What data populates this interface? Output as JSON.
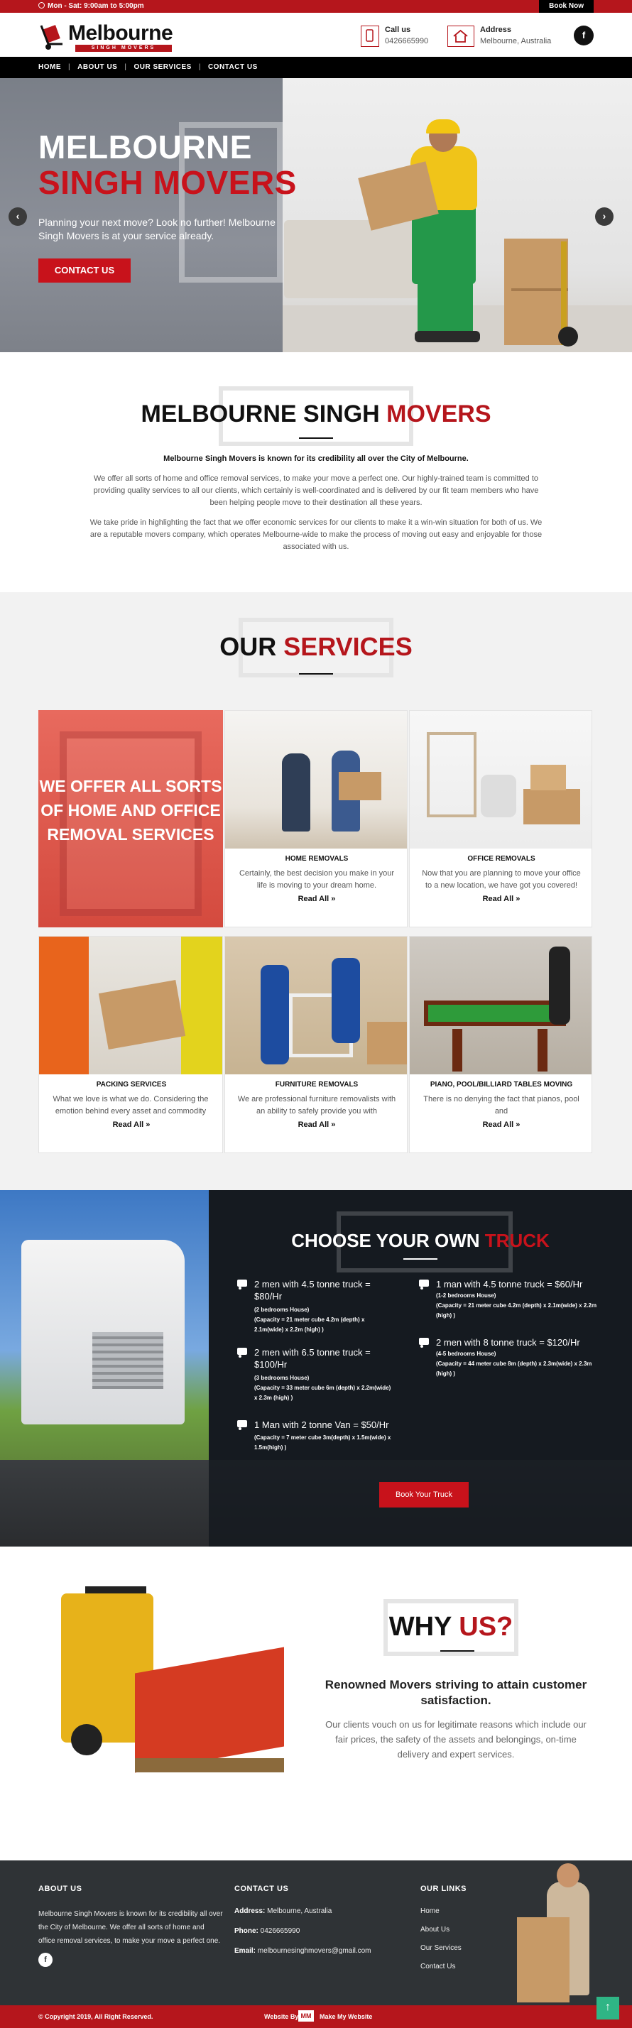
{
  "topbar": {
    "hours": "Mon - Sat: 9:00am to 5:00pm",
    "book_now": "Book Now"
  },
  "header": {
    "logo_name": "Melbourne",
    "logo_sub": "SINGH MOVERS",
    "call_title": "Call us",
    "call_value": "0426665990",
    "address_title": "Address",
    "address_value": "Melbourne, Australia",
    "fb": "f"
  },
  "nav": {
    "items": [
      "HOME",
      "ABOUT US",
      "OUR SERVICES",
      "CONTACT US"
    ],
    "sep": "|"
  },
  "hero": {
    "title_line1": "MELBOURNE",
    "title_line2": "SINGH MOVERS",
    "tagline": "Planning your next move? Look no further! Melbourne Singh Movers is at your service already.",
    "cta": "CONTACT US",
    "prev": "‹",
    "next": "›"
  },
  "about": {
    "title_black": "MELBOURNE SINGH",
    "title_red": "MOVERS",
    "lead": "Melbourne Singh Movers is known for its credibility all over the City of Melbourne.",
    "para1": "We offer all sorts of home and office removal services, to make your move a perfect one. Our highly-trained team is committed to providing quality services to all our clients, which certainly is well-coordinated and is delivered by our fit team members who have been helping people move to their destination all these years.",
    "para2": "We take pride in highlighting the fact that we offer economic services for our clients to make it a win-win situation for both of us. We are a reputable movers company, which operates Melbourne-wide to make the process of moving out easy and enjoyable for those associated with us."
  },
  "services": {
    "title_black": "OUR",
    "title_red": "SERVICES",
    "promo": "WE OFFER ALL SORTS OF HOME AND OFFICE REMOVAL SERVICES",
    "read_all": "Read All »",
    "cards": [
      {
        "title": "HOME REMOVALS",
        "desc": "Certainly, the best decision you make in your life is moving to your dream home."
      },
      {
        "title": "OFFICE REMOVALS",
        "desc": "Now that you are planning to move your office to a new location, we have got you covered!"
      },
      {
        "title": "PACKING SERVICES",
        "desc": "What we love is what we do. Considering the emotion behind every asset and commodity"
      },
      {
        "title": "FURNITURE REMOVALS",
        "desc": "We are professional furniture removalists with an ability to safely provide you with"
      },
      {
        "title": "PIANO, POOL/BILLIARD TABLES MOVING",
        "desc": "There is no denying the fact that pianos, pool and"
      }
    ]
  },
  "trucks": {
    "title_white": "CHOOSE YOUR OWN",
    "title_red": "TRUCK",
    "options": [
      {
        "title": "2 men with 4.5 tonne truck = $80/Hr",
        "house": "(2 bedrooms House)",
        "capacity": "(Capacity = 21 meter cube 4.2m (depth) x 2.1m(wide) x 2.2m (high) )"
      },
      {
        "title": "2 men with 6.5 tonne truck = $100/Hr",
        "house": "(3 bedrooms House)",
        "capacity": "(Capacity = 33 meter cube 6m (depth) x 2.2m(wide) x 2.3m (high) )"
      },
      {
        "title": "1 Man with 2 tonne Van = $50/Hr",
        "house": "",
        "capacity": "(Capacity = 7 meter cube 3m(depth) x 1.5m(wide) x 1.5m(high) )"
      },
      {
        "title": "1 man with 4.5 tonne truck = $60/Hr",
        "house": "(1-2 bedrooms House)",
        "capacity": "(Capacity = 21 meter cube 4.2m (depth) x 2.1m(wide) x 2.2m (high) )"
      },
      {
        "title": "2 men with 8 tonne truck = $120/Hr",
        "house": "(4-5 bedrooms House)",
        "capacity": "(Capacity = 44 meter cube 8m (depth) x 2.3m(wide) x 2.3m (high) )"
      }
    ],
    "book": "Book Your Truck"
  },
  "why": {
    "title_black": "WHY",
    "title_red": "US?",
    "subtitle": "Renowned Movers striving to attain customer satisfaction.",
    "desc": "Our clients vouch on us for legitimate reasons which include our fair prices, the safety of the assets and belongings, on-time delivery and expert services."
  },
  "footer": {
    "about_title": "ABOUT US",
    "about_text": "Melbourne Singh Movers is known for its credibility all over the City of Melbourne. We offer all sorts of home and office removal services, to make your move a perfect one.",
    "fb": "f",
    "contact_title": "CONTACT US",
    "address_label": "Address:",
    "address": "Melbourne, Australia",
    "phone_label": "Phone:",
    "phone": "0426665990",
    "email_label": "Email:",
    "email": "melbournesinghmovers@gmail.com",
    "links_title": "OUR LINKS",
    "links": [
      "Home",
      "About Us",
      "Our Services",
      "Contact Us"
    ],
    "copyright": "© Copyright 2019, All Right Reserved.",
    "credit_prefix": "Website By",
    "credit_logo": "MM",
    "credit_suffix": "Make My Website",
    "to_top": "↑"
  },
  "colors": {
    "brand_red": "#b5161c",
    "accent_green": "#2fb585",
    "footer_dark": "#2f3336"
  }
}
